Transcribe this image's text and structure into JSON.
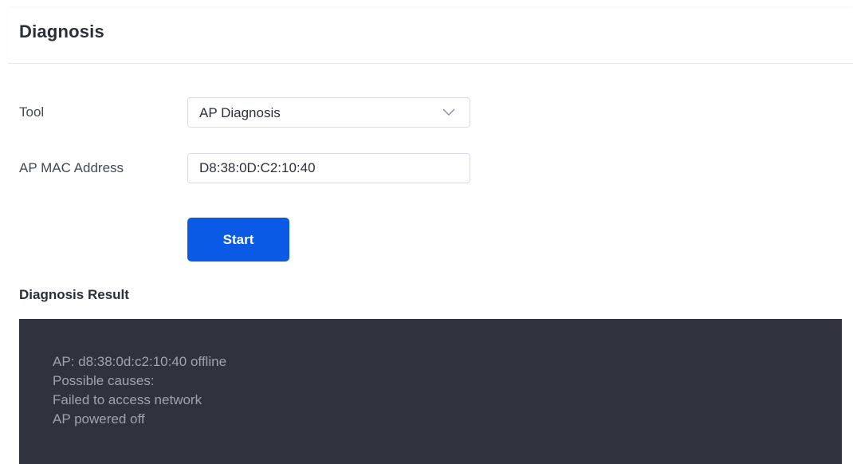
{
  "page": {
    "title": "Diagnosis"
  },
  "form": {
    "tool_label": "Tool",
    "tool_value": "AP Diagnosis",
    "mac_label": "AP MAC Address",
    "mac_value": "D8:38:0D:C2:10:40",
    "start_label": "Start"
  },
  "result": {
    "title": "Diagnosis Result",
    "lines": [
      "AP: d8:38:0d:c2:10:40 offline",
      "Possible causes:",
      "Failed to access network",
      "AP powered off"
    ]
  },
  "icons": {
    "select_arrow": "chevron-down-icon"
  },
  "colors": {
    "primary": "#0a5ae6",
    "result_background": "#30333d",
    "result_text": "#9ea3ad"
  }
}
